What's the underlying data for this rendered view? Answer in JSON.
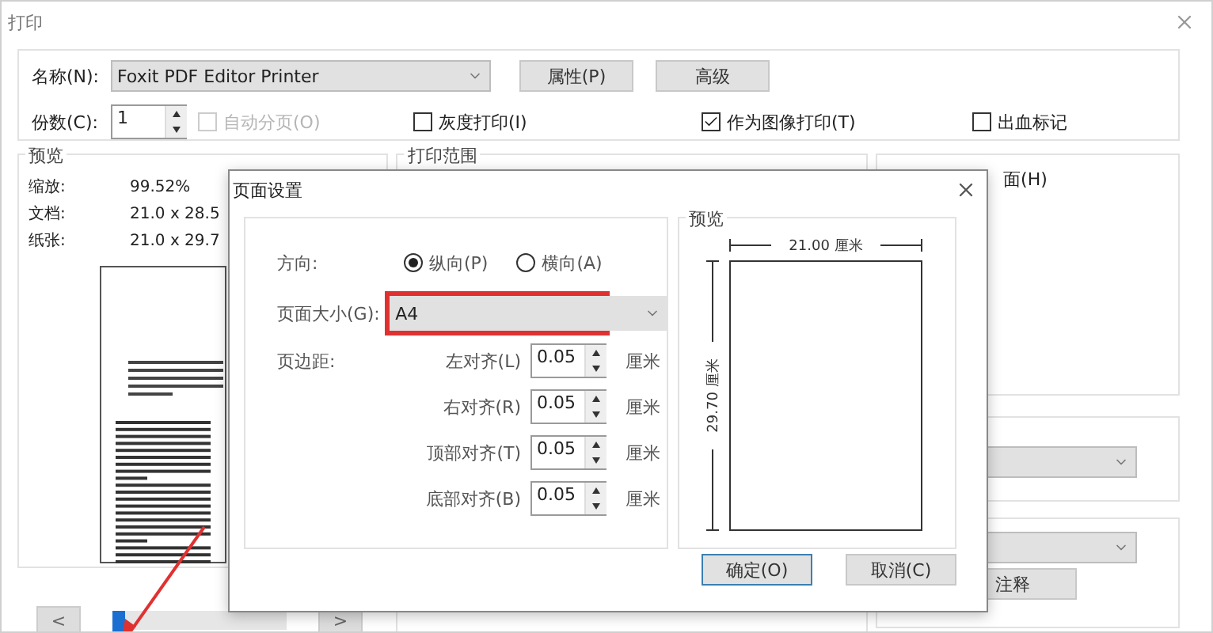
{
  "window": {
    "title": "打印"
  },
  "printer": {
    "label": "名称(N):",
    "value": "Foxit PDF Editor Printer",
    "buttons": [
      "属性(P)",
      "高级"
    ]
  },
  "copies": {
    "label": "份数(C):",
    "value": "1"
  },
  "options": [
    {
      "label": "自动分页(O)",
      "checked": false,
      "disabled": true
    },
    {
      "label": "灰度打印(I)",
      "checked": false,
      "disabled": false
    },
    {
      "label": "作为图像打印(T)",
      "checked": true,
      "disabled": false
    },
    {
      "label": "出血标记",
      "checked": false,
      "disabled": false
    }
  ],
  "preview": {
    "title": "预览",
    "rows": [
      {
        "label": "缩放:",
        "value": "99.52%"
      },
      {
        "label": "文档:",
        "value": "21.0 x 28.5"
      },
      {
        "label": "纸张:",
        "value": "21.0 x 29.7"
      }
    ],
    "prev": "<",
    "next": ">",
    "page_slider": {
      "level": 0
    }
  },
  "print_range": {
    "title": "打印范围"
  },
  "side": {
    "option": "面(H)",
    "button": "注释"
  },
  "page_setup": {
    "title": "页面设置",
    "orientation_label": "方向:",
    "orientations": [
      {
        "label": "纵向(P)",
        "selected": true
      },
      {
        "label": "横向(A)",
        "selected": false
      }
    ],
    "size_label": "页面大小(G):",
    "size_value": "A4",
    "size_highlighted": true,
    "margin_label": "页边距:",
    "margins": [
      {
        "label": "左对齐(L)",
        "value": "0.05",
        "unit": "厘米"
      },
      {
        "label": "右对齐(R)",
        "value": "0.05",
        "unit": "厘米"
      },
      {
        "label": "顶部对齐(T)",
        "value": "0.05",
        "unit": "厘米"
      },
      {
        "label": "底部对齐(B)",
        "value": "0.05",
        "unit": "厘米"
      }
    ],
    "preview_title": "预览",
    "width_label": "21.00 厘米",
    "height_label": "29.70 厘米",
    "buttons": [
      {
        "label": "确定(O)",
        "default": true
      },
      {
        "label": "取消(C)",
        "default": false
      }
    ]
  }
}
